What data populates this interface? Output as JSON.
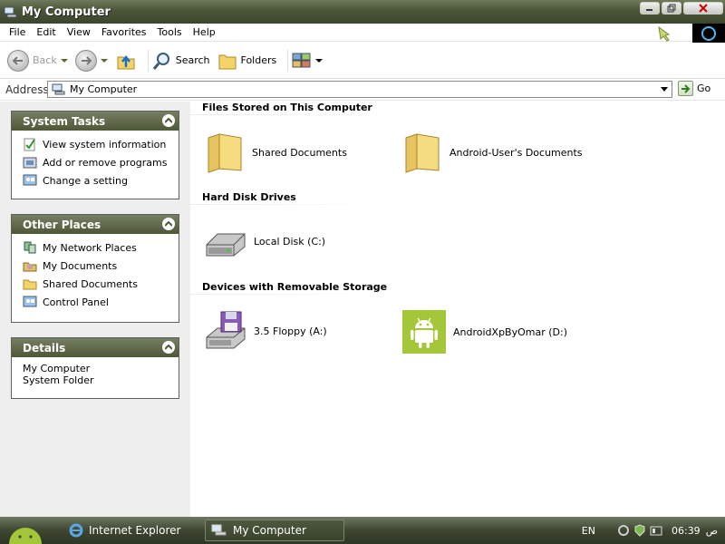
{
  "window": {
    "title": "My Computer",
    "title_icon": "computer-icon"
  },
  "menu": {
    "items": [
      "File",
      "Edit",
      "View",
      "Favorites",
      "Tools",
      "Help"
    ]
  },
  "toolbar": {
    "back_label": "Back",
    "search_label": "Search",
    "folders_label": "Folders"
  },
  "address": {
    "label": "Address",
    "value": "My Computer",
    "go_label": "Go"
  },
  "sidebar": {
    "system_tasks": {
      "title": "System Tasks",
      "items": [
        {
          "label": "View system information",
          "icon": "info-check-icon"
        },
        {
          "label": "Add or remove programs",
          "icon": "programs-icon"
        },
        {
          "label": "Change a setting",
          "icon": "control-panel-icon"
        }
      ]
    },
    "other_places": {
      "title": "Other Places",
      "items": [
        {
          "label": "My Network Places",
          "icon": "network-icon"
        },
        {
          "label": "My Documents",
          "icon": "documents-icon"
        },
        {
          "label": "Shared Documents",
          "icon": "folder-icon"
        },
        {
          "label": "Control Panel",
          "icon": "control-panel-icon"
        }
      ]
    },
    "details": {
      "title": "Details",
      "line1": "My Computer",
      "line2": "System Folder"
    }
  },
  "main": {
    "groups": [
      {
        "title": "Files Stored on This Computer",
        "items": [
          {
            "label": "Shared Documents",
            "icon": "folder-icon"
          },
          {
            "label": "Android-User's Documents",
            "icon": "folder-icon"
          }
        ]
      },
      {
        "title": "Hard Disk Drives",
        "items": [
          {
            "label": "Local Disk (C:)",
            "icon": "hard-disk-icon"
          }
        ]
      },
      {
        "title": "Devices with Removable Storage",
        "items": [
          {
            "label": "3.5 Floppy (A:)",
            "icon": "floppy-drive-icon"
          },
          {
            "label": "AndroidXpByOmar (D:)",
            "icon": "android-drive-icon"
          }
        ]
      }
    ]
  },
  "taskbar": {
    "buttons": [
      {
        "label": "Internet Explorer"
      },
      {
        "label": "My Computer"
      }
    ],
    "tray": {
      "lang": "EN",
      "time": "06:39",
      "ampm": "ص"
    }
  },
  "colors": {
    "accent": "#4d5837",
    "android_green": "#a4c639",
    "folder": "#f3d46b"
  }
}
